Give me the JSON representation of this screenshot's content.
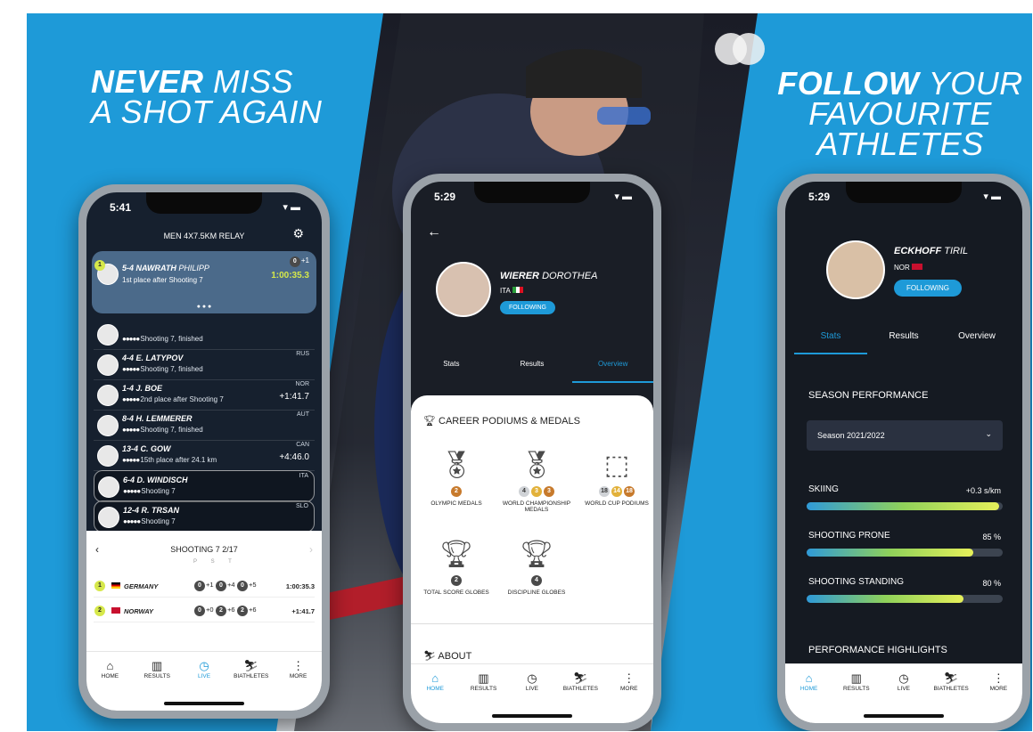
{
  "left_headline": {
    "bold": "NEVER",
    "light": "MISS",
    "line2": "A SHOT AGAIN"
  },
  "right_headline": {
    "bold": "FOLLOW",
    "light": "YOUR",
    "line2": "FAVOURITE",
    "line3": "ATHLETES"
  },
  "colors": {
    "brand_blue": "#1e9ad8",
    "highlight_yellow": "#d6e84a"
  },
  "left_phone": {
    "time": "5:41",
    "title": "MEN 4X7.5KM RELAY",
    "leader": {
      "bib": "5-4",
      "last": "NAWRATH",
      "first": "PHILIPP",
      "sub": "1st place after Shooting 7",
      "time": "1:00:35.3",
      "misses": "+1",
      "rank": "1"
    },
    "rows": [
      {
        "bib": "",
        "name": "",
        "sub": "Shooting 7, finished",
        "country": "",
        "time": ""
      },
      {
        "bib": "4-4",
        "name": "E. LATYPOV",
        "sub": "Shooting 7, finished",
        "country": "RUS",
        "time": ""
      },
      {
        "bib": "1-4",
        "name": "J. BOE",
        "sub": "2nd place after Shooting 7",
        "country": "NOR",
        "time": "+1:41.7"
      },
      {
        "bib": "8-4",
        "name": "H. LEMMERER",
        "sub": "Shooting 7, finished",
        "country": "AUT",
        "time": ""
      },
      {
        "bib": "13-4",
        "name": "C. GOW",
        "sub": "15th place after 24.1 km",
        "country": "CAN",
        "time": "+4:46.0"
      },
      {
        "bib": "6-4",
        "name": "D. WINDISCH",
        "sub": "Shooting 7",
        "country": "ITA",
        "time": ""
      },
      {
        "bib": "12-4",
        "name": "R. TRSAN",
        "sub": "Shooting 7",
        "country": "SLO",
        "time": ""
      }
    ],
    "shooting": {
      "title": "SHOOTING 7 2/17",
      "cols": [
        "P",
        "S",
        "T"
      ],
      "rows": [
        {
          "rank": "1",
          "team": "GERMANY",
          "p": "+1",
          "s": "+4",
          "t": "+5",
          "p_miss": "0",
          "s_miss": "0",
          "t_miss": "0",
          "time": "1:00:35.3"
        },
        {
          "rank": "2",
          "team": "NORWAY",
          "p": "+0",
          "s": "+6",
          "t": "+6",
          "p_miss": "0",
          "s_miss": "2",
          "t_miss": "2",
          "time": "+1:41.7"
        }
      ]
    },
    "tabs": [
      {
        "icon": "⌂",
        "label": "HOME",
        "active": false
      },
      {
        "icon": "▥",
        "label": "RESULTS",
        "active": false
      },
      {
        "icon": "◷",
        "label": "LIVE",
        "active": true
      },
      {
        "icon": "⛷",
        "label": "BIATHLETES",
        "active": false
      },
      {
        "icon": "⋮",
        "label": "MORE",
        "active": false
      }
    ]
  },
  "middle_phone": {
    "time": "5:29",
    "athlete": {
      "last": "WIERER",
      "first": "DOROTHEA",
      "country": "ITA",
      "follow": "FOLLOWING"
    },
    "tabs_top": [
      "Stats",
      "Results",
      "Overview"
    ],
    "section_title": "CAREER PODIUMS & MEDALS",
    "medals": [
      {
        "label": "OLYMPIC MEDALS",
        "badges": [
          "2"
        ]
      },
      {
        "label": "WORLD CHAMPIONSHIP MEDALS",
        "badges": [
          "4",
          "3",
          "3"
        ]
      },
      {
        "label": "WORLD CUP PODIUMS",
        "badges": [
          "18",
          "14",
          "18"
        ]
      },
      {
        "label": "TOTAL SCORE GLOBES",
        "badges": [
          "2"
        ]
      },
      {
        "label": "DISCIPLINE GLOBES",
        "badges": [
          "4"
        ]
      }
    ],
    "about": "ABOUT",
    "tabs": [
      {
        "icon": "⌂",
        "label": "HOME",
        "active": true
      },
      {
        "icon": "▥",
        "label": "RESULTS",
        "active": false
      },
      {
        "icon": "◷",
        "label": "LIVE",
        "active": false
      },
      {
        "icon": "⛷",
        "label": "BIATHLETES",
        "active": false
      },
      {
        "icon": "⋮",
        "label": "MORE",
        "active": false
      }
    ]
  },
  "right_phone": {
    "time": "5:29",
    "athlete": {
      "last": "ECKHOFF",
      "first": "TIRIL",
      "country": "NOR",
      "follow": "FOLLOWING"
    },
    "tabs_top": [
      "Stats",
      "Results",
      "Overview"
    ],
    "season_title": "SEASON PERFORMANCE",
    "season_select": "Season 2021/2022",
    "stats": [
      {
        "label": "SKIING",
        "value": "+0.3 s/km",
        "fill": 0.98
      },
      {
        "label": "SHOOTING PRONE",
        "value": "85 %",
        "fill": 0.85
      },
      {
        "label": "SHOOTING STANDING",
        "value": "80 %",
        "fill": 0.8
      }
    ],
    "highlights": "PERFORMANCE HIGHLIGHTS",
    "tabs": [
      {
        "icon": "⌂",
        "label": "HOME",
        "active": true
      },
      {
        "icon": "▥",
        "label": "RESULTS",
        "active": false
      },
      {
        "icon": "◷",
        "label": "LIVE",
        "active": false
      },
      {
        "icon": "⛷",
        "label": "BIATHLETES",
        "active": false
      },
      {
        "icon": "⋮",
        "label": "MORE",
        "active": false
      }
    ]
  }
}
